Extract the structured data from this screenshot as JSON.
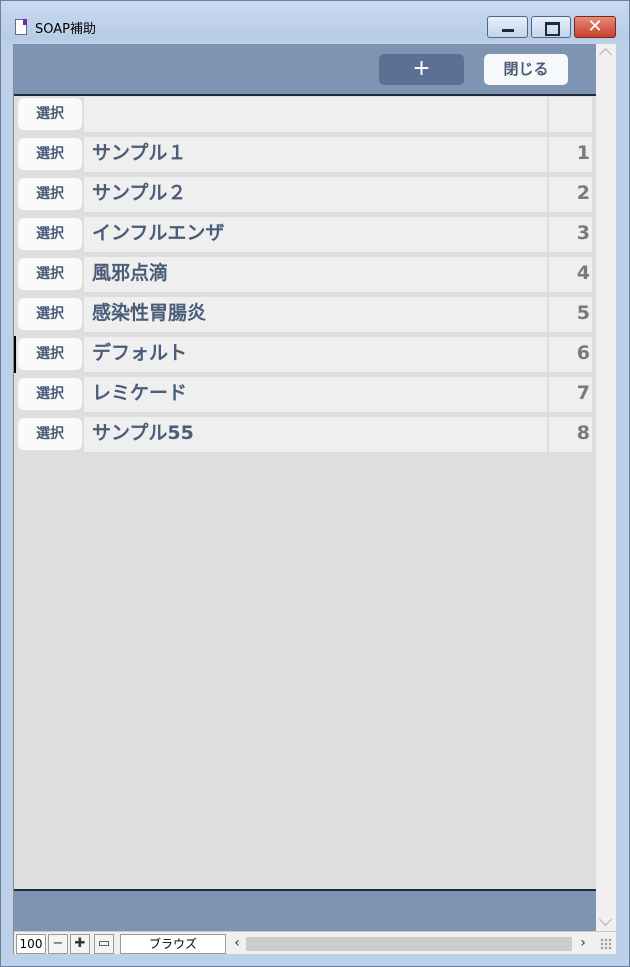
{
  "window": {
    "title": "SOAP補助",
    "app_icon": "document-icon"
  },
  "toolbar": {
    "add_label": "+",
    "close_label": "閉じる"
  },
  "list": {
    "select_label": "選択",
    "rows": [
      {
        "name": "",
        "number": ""
      },
      {
        "name": "サンプル１",
        "number": "1"
      },
      {
        "name": "サンプル２",
        "number": "2"
      },
      {
        "name": "インフルエンザ",
        "number": "3"
      },
      {
        "name": "風邪点滴",
        "number": "4"
      },
      {
        "name": "感染性胃腸炎",
        "number": "5"
      },
      {
        "name": "デフォルト",
        "number": "6"
      },
      {
        "name": "レミケード",
        "number": "7"
      },
      {
        "name": "サンプル55",
        "number": "8"
      }
    ],
    "active_row": 6
  },
  "statusbar": {
    "zoom": "100",
    "mode": "ブラウズ"
  },
  "colors": {
    "header": "#7f94b2",
    "text_accent": "#4a5c78",
    "add_button": "#5b7092"
  }
}
